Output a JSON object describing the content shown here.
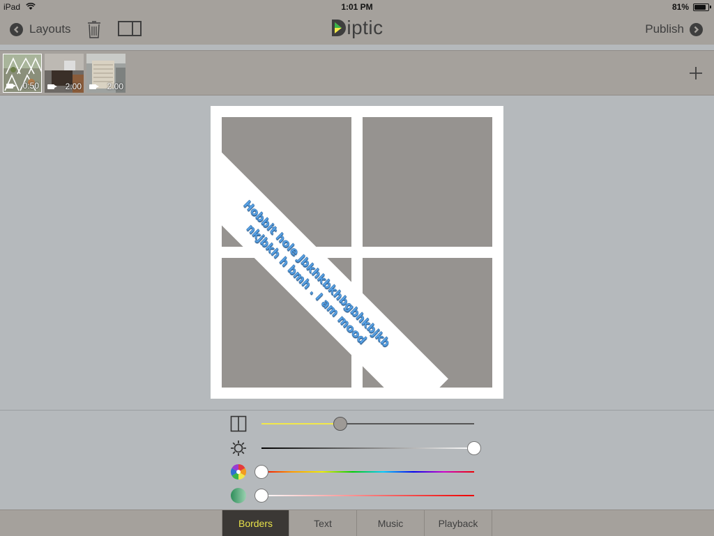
{
  "status_bar": {
    "device": "iPad",
    "time": "1:01 PM",
    "battery": "81%"
  },
  "nav": {
    "back_label": "Layouts",
    "app_title": "iptic",
    "publish_label": "Publish"
  },
  "media_strip": {
    "items": [
      {
        "duration": "0:50",
        "selected": true
      },
      {
        "duration": "2:00",
        "selected": false
      },
      {
        "duration": "2:00",
        "selected": false
      }
    ]
  },
  "canvas": {
    "cells": 4,
    "banner_text": "Hobbit hole Jbkhkbkhbgbhkbjkb nkjbkh h bmh . I am mood"
  },
  "controls": {
    "border_size": 0.37,
    "brightness": 1.0,
    "hue": 0.0,
    "saturation": 0.0
  },
  "tabs": [
    {
      "label": "Borders",
      "active": true
    },
    {
      "label": "Text",
      "active": false
    },
    {
      "label": "Music",
      "active": false
    },
    {
      "label": "Playback",
      "active": false
    }
  ],
  "colors": {
    "bar_background": "#a5a19c",
    "page_background": "#b5b9bc",
    "accent_yellow": "#f2e84a",
    "banner_text": "#5aa3e6",
    "cell_gray": "#969390"
  }
}
